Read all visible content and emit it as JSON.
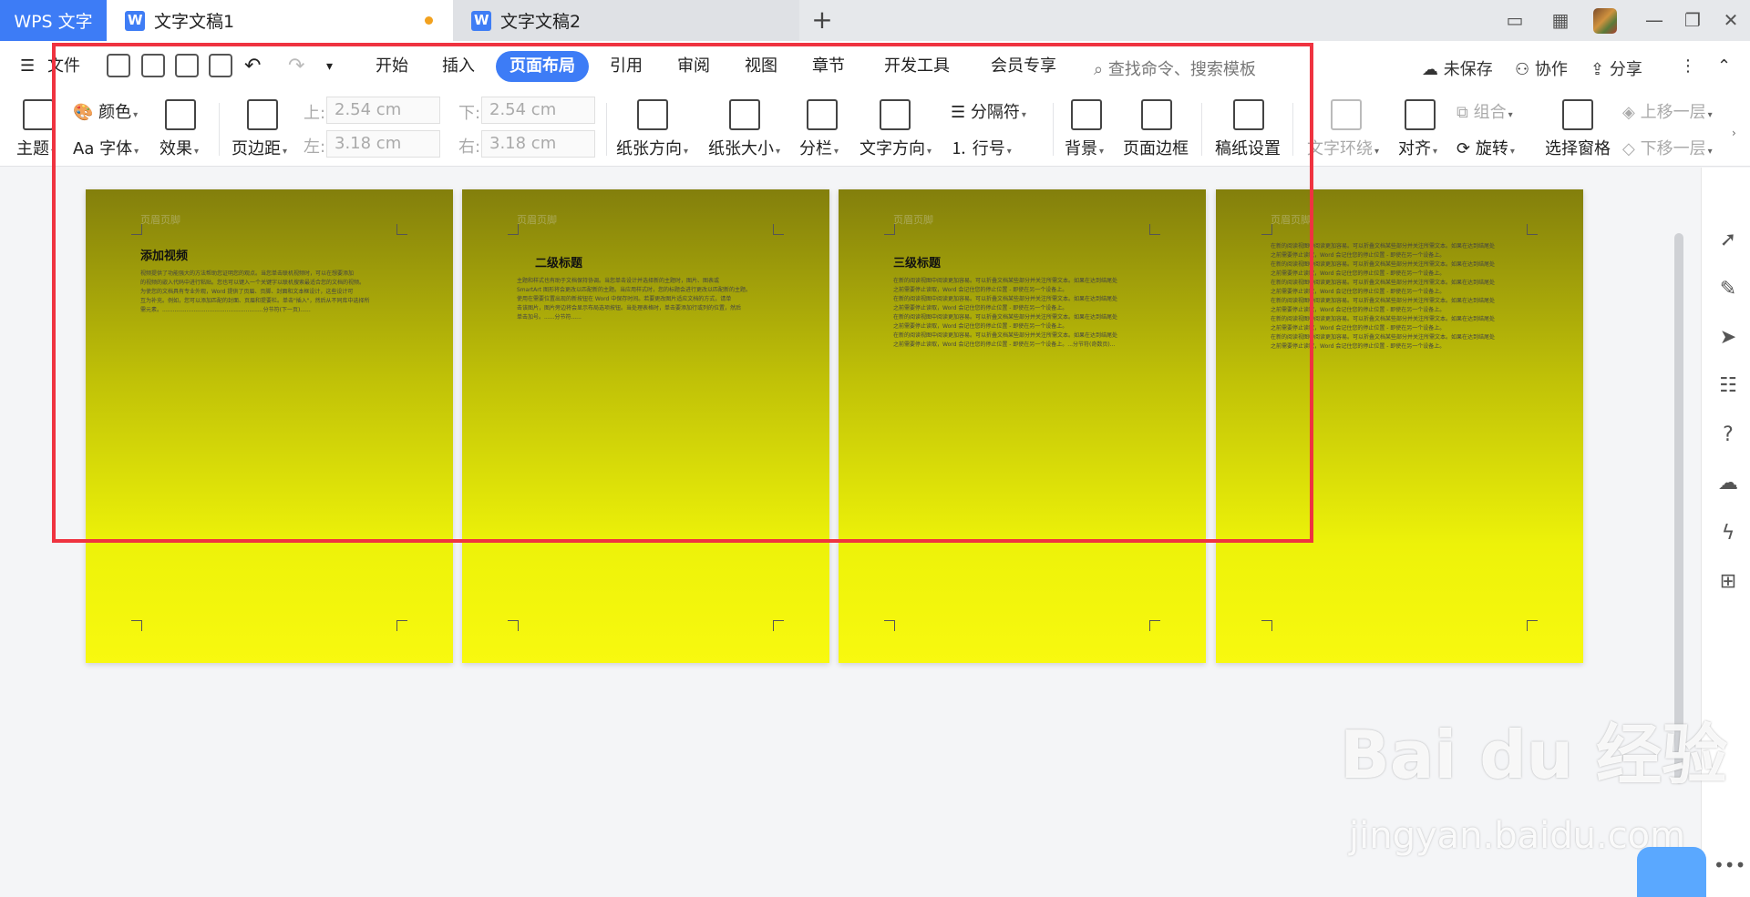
{
  "tabs": {
    "app": "WPS 文字",
    "active_doc": "文字文稿1",
    "inactive_doc": "文字文稿2",
    "add": "+"
  },
  "window_controls": {
    "minimize": "—",
    "restore": "❐",
    "close": "✕"
  },
  "menubar": {
    "file": "文件",
    "items": [
      "开始",
      "插入",
      "页面布局",
      "引用",
      "审阅",
      "视图",
      "章节",
      "开发工具",
      "会员专享"
    ],
    "active_item": "页面布局",
    "search_placeholder": "查找命令、搜索模板",
    "unsaved": "未保存",
    "collab": "协作",
    "share": "分享"
  },
  "ribbon": {
    "theme": "主题",
    "color": "颜色",
    "font": "字体",
    "font_prefix": "Aa",
    "effect": "效果",
    "margins": "页边距",
    "top_label": "上:",
    "top_value": "2.54 cm",
    "bottom_label": "下:",
    "bottom_value": "2.54 cm",
    "left_label": "左:",
    "left_value": "3.18 cm",
    "right_label": "右:",
    "right_value": "3.18 cm",
    "orientation": "纸张方向",
    "size": "纸张大小",
    "columns": "分栏",
    "text_direction": "文字方向",
    "separator": "分隔符",
    "line_number": "行号",
    "background": "背景",
    "page_border": "页面边框",
    "manuscript": "稿纸设置",
    "text_wrap": "文字环绕",
    "align": "对齐",
    "rotate": "旋转",
    "group": "组合",
    "selection_pane": "选择窗格",
    "bring_forward": "上移一层",
    "send_backward": "下移一层"
  },
  "pages": [
    {
      "header": "页眉页脚",
      "heading": "添加视频",
      "lines": [
        "视频提供了功能强大的方法帮助您证明您的观点。当您单击联机视频时，可以在想要添加",
        "的视频的嵌入代码中进行粘贴。您也可以键入一个关键字以联机搜索最适合您的文档的视频。",
        "为使您的文档具有专业外观，Word 提供了页眉、页脚、封面和文本框设计，这些设计可",
        "互为补充。例如，您可以添加匹配的封面、页眉和提要栏。单击\"插入\"，然后从不同库中选择所",
        "需元素。..........................................................分节符(下一页)......"
      ]
    },
    {
      "header": "页眉页脚",
      "heading": "二级标题",
      "lines": [
        "主题和样式也有助于文档保持协调。当您单击设计并选择新的主题时，图片、图表或",
        "SmartArt 图形将会更改以匹配新的主题。当应用样式时，您的标题会进行更改以匹配新的主题。",
        "使用在需要位置出现的新按钮在 Word 中保存时间。若要更改图片适应文档的方式，请单",
        "击该图片，图片旁边将会显示布局选项按钮。当处理表格时，单击要添加行或列的位置，然后",
        "单击加号。......分节符......"
      ]
    },
    {
      "header": "页眉页脚",
      "heading": "三级标题",
      "lines": [
        "在新的阅读视图中阅读更加容易。可以折叠文档某些部分并关注所需文本。如果在达到结尾处",
        "之前需要停止读取，Word 会记住您的停止位置 - 即使在另一个设备上。",
        "在新的阅读视图中阅读更加容易。可以折叠文档某些部分并关注所需文本。如果在达到结尾处",
        "之前需要停止读取，Word 会记住您的停止位置 - 即使在另一个设备上。",
        "在新的阅读视图中阅读更加容易。可以折叠文档某些部分并关注所需文本。如果在达到结尾处",
        "之前需要停止读取，Word 会记住您的停止位置 - 即使在另一个设备上。",
        "在新的阅读视图中阅读更加容易。可以折叠文档某些部分并关注所需文本。如果在达到结尾处",
        "之前需要停止读取，Word 会记住您的停止位置 - 即使在另一个设备上。...分节符(奇数页)..."
      ]
    },
    {
      "header": "页眉页脚",
      "heading": "",
      "lines": [
        "在新的阅读视图中阅读更加容易。可以折叠文档某些部分并关注所需文本。如果在达到结尾处",
        "之前需要停止读取，Word 会记住您的停止位置 - 即使在另一个设备上。",
        "在新的阅读视图中阅读更加容易。可以折叠文档某些部分并关注所需文本。如果在达到结尾处",
        "之前需要停止读取，Word 会记住您的停止位置 - 即使在另一个设备上。",
        "在新的阅读视图中阅读更加容易。可以折叠文档某些部分并关注所需文本。如果在达到结尾处",
        "之前需要停止读取，Word 会记住您的停止位置 - 即使在另一个设备上。",
        "在新的阅读视图中阅读更加容易。可以折叠文档某些部分并关注所需文本。如果在达到结尾处",
        "之前需要停止读取，Word 会记住您的停止位置 - 即使在另一个设备上。",
        "在新的阅读视图中阅读更加容易。可以折叠文档某些部分并关注所需文本。如果在达到结尾处",
        "之前需要停止读取，Word 会记住您的停止位置 - 即使在另一个设备上。",
        "在新的阅读视图中阅读更加容易。可以折叠文档某些部分并关注所需文本。如果在达到结尾处",
        "之前需要停止读取，Word 会记住您的停止位置 - 即使在另一个设备上。"
      ]
    }
  ],
  "watermark": {
    "brand": "Bai du 经验",
    "url": "jingyan.baidu.com"
  },
  "colors": {
    "accent": "#3d7cf6",
    "highlight_border": "#ef3340",
    "page_top": "#837f0c",
    "page_bottom": "#f8f90f"
  }
}
